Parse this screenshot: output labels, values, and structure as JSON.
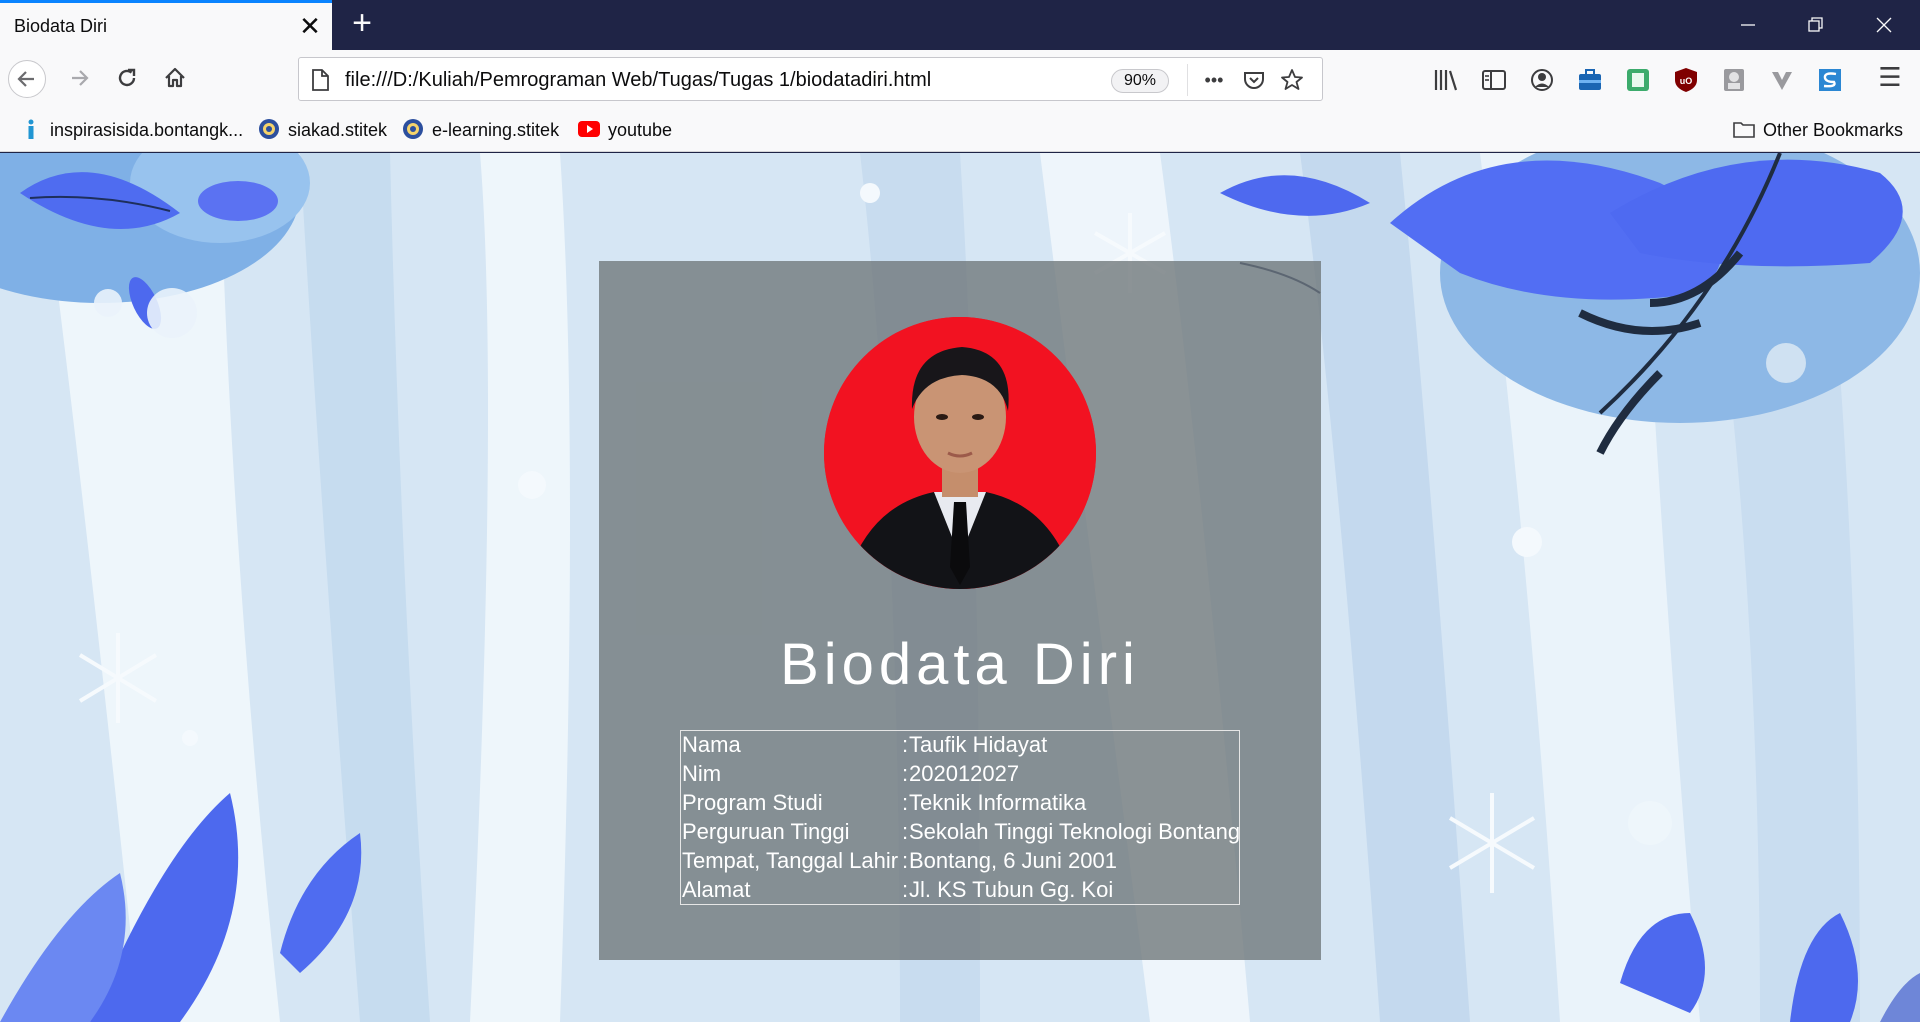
{
  "browser": {
    "tab": {
      "title": "Biodata Diri",
      "close": "✕"
    },
    "new_tab": "+",
    "window": {
      "minimize": "—",
      "restore": "❐",
      "close": "✕"
    },
    "url": "file:///D:/Kuliah/Pemrograman Web/Tugas/Tugas 1/biodatadiri.html",
    "zoom": "90%",
    "page_actions": "•••",
    "bookmarks": [
      {
        "label": "inspirasisida.bontangk..."
      },
      {
        "label": "siakad.stitek"
      },
      {
        "label": "e-learning.stitek"
      },
      {
        "label": "youtube"
      }
    ],
    "other_bookmarks": "Other Bookmarks",
    "menu": "☰"
  },
  "page": {
    "title": "Biodata Diri",
    "biodata": [
      {
        "label": "Nama",
        "sep": ":",
        "value": "Taufik Hidayat"
      },
      {
        "label": "Nim",
        "sep": ":",
        "value": "202012027"
      },
      {
        "label": "Program Studi",
        "sep": ":",
        "value": "Teknik Informatika"
      },
      {
        "label": "Perguruan Tinggi",
        "sep": ":",
        "value": "Sekolah Tinggi Teknologi Bontang"
      },
      {
        "label": "Tempat, Tanggal Lahir",
        "sep": ":",
        "value": "Bontang, 6 Juni 2001"
      },
      {
        "label": "Alamat",
        "sep": ":",
        "value": "Jl. KS Tubun Gg. Koi"
      }
    ]
  },
  "colors": {
    "tabstrip": "#1f2446",
    "accent": "#0a84ff",
    "photo_background": "#f21221"
  }
}
